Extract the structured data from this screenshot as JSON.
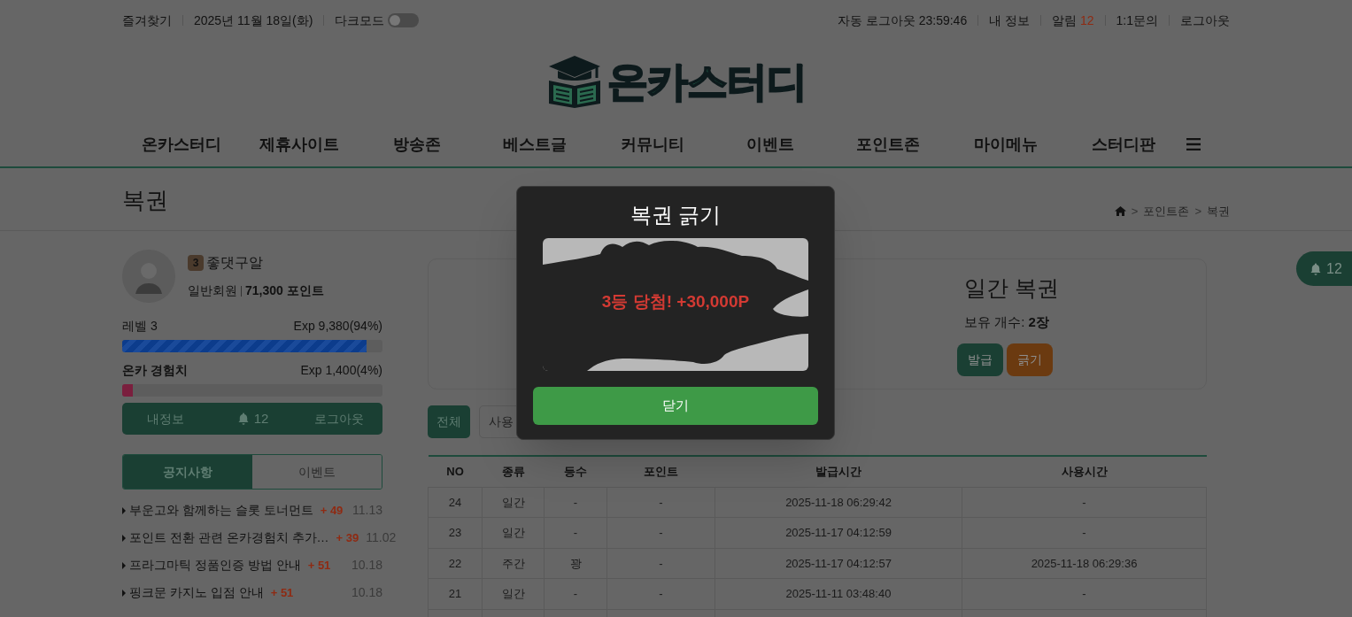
{
  "top_bar": {
    "left_items": [
      {
        "text": "즐겨찾기"
      },
      {
        "text": "2025년 11월 18일(화)"
      }
    ],
    "dark_mode": {
      "label": "다크모드",
      "on": false
    },
    "right_items": [
      {
        "text": "자동 로그아웃 23:59:46"
      },
      {
        "text": "내 정보"
      },
      {
        "text": "알림",
        "count": "12"
      },
      {
        "text": "1:1문의"
      },
      {
        "text": "로그아웃"
      }
    ]
  },
  "logo": {
    "text": "온카스터디"
  },
  "nav": {
    "items": [
      "온카스터디",
      "제휴사이트",
      "방송존",
      "베스트글",
      "커뮤니티",
      "이벤트",
      "포인트존",
      "마이메뉴",
      "스터디판"
    ]
  },
  "page_title": "복권",
  "breadcrumb": {
    "separator": ">",
    "items": [
      "포인트존",
      "복권"
    ]
  },
  "profile": {
    "level_badge": "3",
    "name": "좋댓구알",
    "grade": "일반회원",
    "points": "71,300 포인트",
    "bars": [
      {
        "kind": "level",
        "label": "레벨 3",
        "reading": "Exp 9,380(94%)",
        "level": 0.94
      },
      {
        "kind": "exp",
        "label": "온카 경험치",
        "reading": "Exp 1,400(4%)",
        "level": 0.04
      }
    ],
    "actions": [
      {
        "kind": "link",
        "text": "내정보"
      },
      {
        "kind": "bell",
        "text": "12"
      },
      {
        "kind": "link",
        "text": "로그아웃"
      }
    ]
  },
  "board_tabs": [
    {
      "label": "공지사항",
      "selected": true
    },
    {
      "label": "이벤트",
      "selected": false
    }
  ],
  "notices": [
    {
      "title": "부운고와 함께하는 슬롯 토너먼트",
      "bonus": "+ 49",
      "date": "11.13"
    },
    {
      "title": "포인트 전환 관련 온카경험치 추가…",
      "bonus": "+ 39",
      "date": "11.02"
    },
    {
      "title": "프라그마틱 정품인증 방법 안내",
      "bonus": "+ 51",
      "date": "10.18"
    },
    {
      "title": "핑크문 카지노 입점 안내",
      "bonus": "+ 51",
      "date": "10.18"
    }
  ],
  "lottery_card": {
    "title": "일간 복권",
    "count": "보유 개수: **2장**",
    "buttons": [
      {
        "kind": "issue",
        "label": "발급"
      },
      {
        "kind": "scratch",
        "label": "긁기"
      }
    ]
  },
  "filters": [
    {
      "label": "전체",
      "selected": true
    },
    {
      "label": "사용",
      "selected": false
    }
  ],
  "table": {
    "columns": [
      "NO",
      "종류",
      "등수",
      "포인트",
      "발급시간",
      "사용시간"
    ],
    "rows": [
      [
        "24",
        "일간",
        "-",
        "-",
        "2025-11-18 06:29:42",
        "-"
      ],
      [
        "23",
        "일간",
        "-",
        "-",
        "2025-11-17 04:12:59",
        "-"
      ],
      [
        "22",
        "주간",
        "꽝",
        "-",
        "2025-11-17 04:12:57",
        "2025-11-18 06:29:36"
      ],
      [
        "21",
        "일간",
        "-",
        "-",
        "2025-11-11 03:48:40",
        "-"
      ]
    ]
  },
  "floating_alert": {
    "count": "12"
  },
  "modal": {
    "title": "복권 긁기",
    "result": "3등 당첨! +30,000P",
    "button": "닫기"
  }
}
